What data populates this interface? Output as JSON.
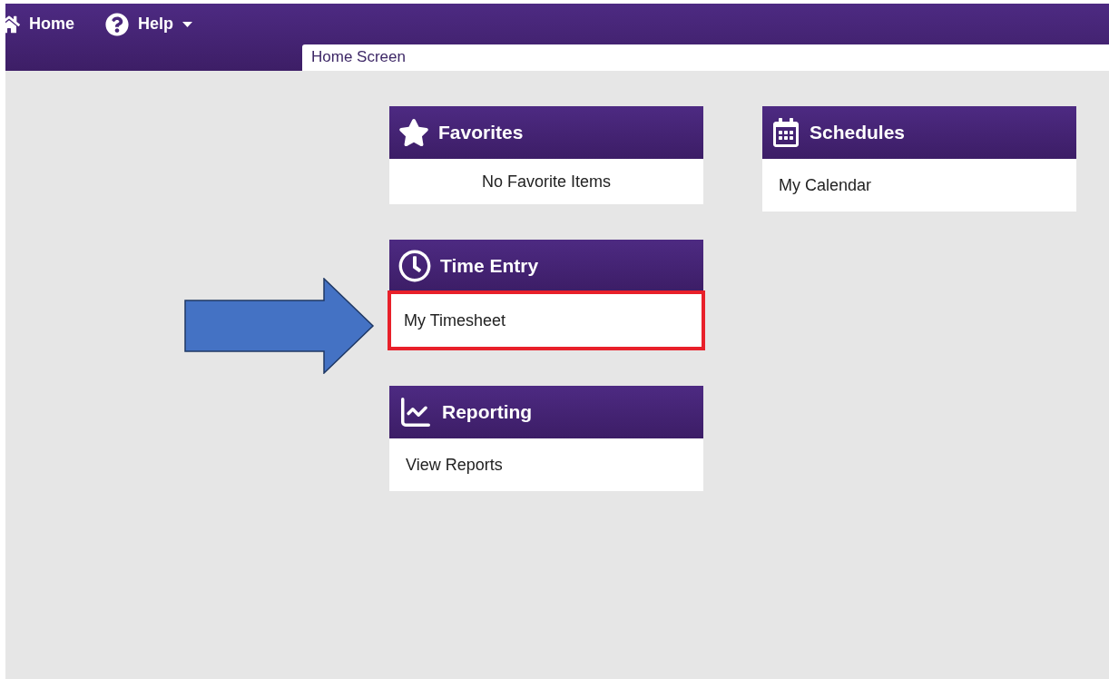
{
  "nav": {
    "items": [
      {
        "kind": "home",
        "label": "Home",
        "has_menu": false
      },
      {
        "kind": "help",
        "label": "Help",
        "has_menu": true
      }
    ]
  },
  "tabs": [
    {
      "label": "Home Screen",
      "selected": true
    }
  ],
  "columns": [
    {
      "cards": [
        {
          "kind": "star",
          "title": "Favorites",
          "items": [
            {
              "kind": "empty",
              "label": "No Favorite Items",
              "highlighted": false
            }
          ]
        },
        {
          "kind": "clock",
          "title": "Time Entry",
          "items": [
            {
              "kind": "link",
              "label": "My Timesheet",
              "highlighted": true
            }
          ]
        },
        {
          "kind": "chart",
          "title": "Reporting",
          "items": [
            {
              "kind": "link",
              "label": "View Reports",
              "highlighted": false
            }
          ]
        }
      ]
    },
    {
      "cards": [
        {
          "kind": "calendar",
          "title": "Schedules",
          "items": [
            {
              "kind": "link",
              "label": "My Calendar",
              "highlighted": false
            }
          ]
        }
      ]
    }
  ]
}
